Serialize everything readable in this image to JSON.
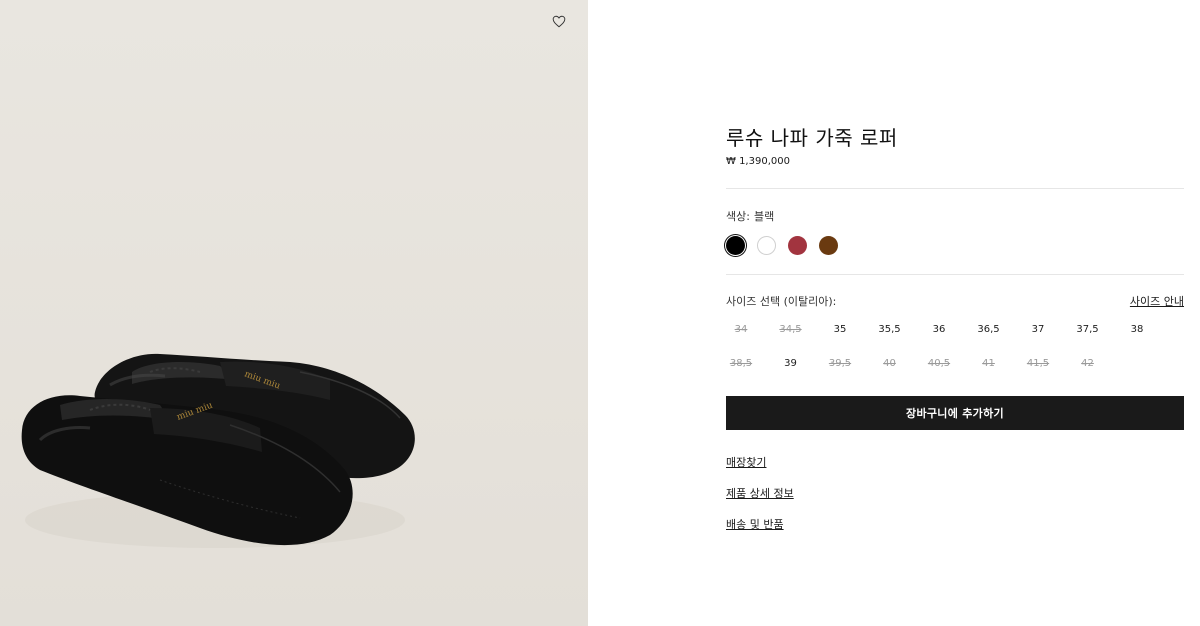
{
  "product": {
    "title": "루슈 나파 가죽 로퍼",
    "price": "₩ 1,390,000"
  },
  "color": {
    "label": "색상:",
    "selected": "블랙",
    "swatches": [
      {
        "name": "black",
        "hex": "#000000",
        "selected": true
      },
      {
        "name": "white",
        "hex": "#ffffff",
        "selected": false
      },
      {
        "name": "red",
        "hex": "#a2343f",
        "selected": false
      },
      {
        "name": "brown",
        "hex": "#6a3a10",
        "selected": false
      }
    ]
  },
  "sizes": {
    "label": "사이즈 선택 (이탈리아):",
    "guide_link": "사이즈 안내",
    "items": [
      {
        "value": "34",
        "available": false
      },
      {
        "value": "34,5",
        "available": false
      },
      {
        "value": "35",
        "available": true
      },
      {
        "value": "35,5",
        "available": true
      },
      {
        "value": "36",
        "available": true
      },
      {
        "value": "36,5",
        "available": true
      },
      {
        "value": "37",
        "available": true
      },
      {
        "value": "37,5",
        "available": true
      },
      {
        "value": "38",
        "available": true
      },
      {
        "value": "38,5",
        "available": false
      },
      {
        "value": "39",
        "available": true
      },
      {
        "value": "39,5",
        "available": false
      },
      {
        "value": "40",
        "available": false
      },
      {
        "value": "40,5",
        "available": false
      },
      {
        "value": "41",
        "available": false
      },
      {
        "value": "41,5",
        "available": false
      },
      {
        "value": "42",
        "available": false
      }
    ]
  },
  "actions": {
    "add_to_cart": "장바구니에 추가하기",
    "store_finder": "매장찾기",
    "product_details": "제품 상세 정보",
    "shipping_returns": "배송 및 반품"
  },
  "image": {
    "logo_text": "miu miu"
  }
}
